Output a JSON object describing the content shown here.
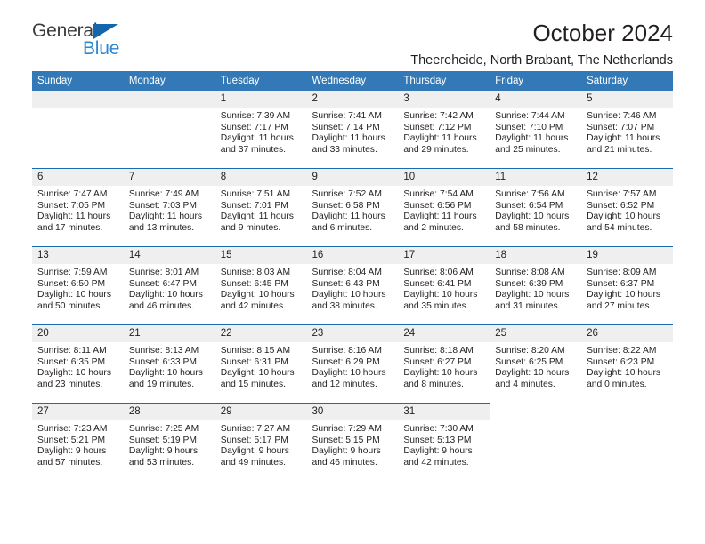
{
  "brand": {
    "word1": "General",
    "word2": "Blue",
    "triangle_color": "#1565ad",
    "word2_color": "#2f87d1"
  },
  "header": {
    "title": "October 2024",
    "subtitle": "Theereheide, North Brabant, The Netherlands"
  },
  "theme": {
    "header_bg": "#3379b7",
    "row_divider": "#1a6cb0",
    "daynum_bg": "#efefef",
    "text": "#231f20"
  },
  "weekdays": [
    "Sunday",
    "Monday",
    "Tuesday",
    "Wednesday",
    "Thursday",
    "Friday",
    "Saturday"
  ],
  "labels": {
    "sunrise": "Sunrise:",
    "sunset": "Sunset:",
    "daylight": "Daylight:"
  },
  "weeks": [
    [
      {
        "day": "",
        "empty": true
      },
      {
        "day": "",
        "empty": true
      },
      {
        "day": "1",
        "sunrise": "Sunrise: 7:39 AM",
        "sunset": "Sunset: 7:17 PM",
        "daylight": "Daylight: 11 hours and 37 minutes."
      },
      {
        "day": "2",
        "sunrise": "Sunrise: 7:41 AM",
        "sunset": "Sunset: 7:14 PM",
        "daylight": "Daylight: 11 hours and 33 minutes."
      },
      {
        "day": "3",
        "sunrise": "Sunrise: 7:42 AM",
        "sunset": "Sunset: 7:12 PM",
        "daylight": "Daylight: 11 hours and 29 minutes."
      },
      {
        "day": "4",
        "sunrise": "Sunrise: 7:44 AM",
        "sunset": "Sunset: 7:10 PM",
        "daylight": "Daylight: 11 hours and 25 minutes."
      },
      {
        "day": "5",
        "sunrise": "Sunrise: 7:46 AM",
        "sunset": "Sunset: 7:07 PM",
        "daylight": "Daylight: 11 hours and 21 minutes."
      }
    ],
    [
      {
        "day": "6",
        "sunrise": "Sunrise: 7:47 AM",
        "sunset": "Sunset: 7:05 PM",
        "daylight": "Daylight: 11 hours and 17 minutes."
      },
      {
        "day": "7",
        "sunrise": "Sunrise: 7:49 AM",
        "sunset": "Sunset: 7:03 PM",
        "daylight": "Daylight: 11 hours and 13 minutes."
      },
      {
        "day": "8",
        "sunrise": "Sunrise: 7:51 AM",
        "sunset": "Sunset: 7:01 PM",
        "daylight": "Daylight: 11 hours and 9 minutes."
      },
      {
        "day": "9",
        "sunrise": "Sunrise: 7:52 AM",
        "sunset": "Sunset: 6:58 PM",
        "daylight": "Daylight: 11 hours and 6 minutes."
      },
      {
        "day": "10",
        "sunrise": "Sunrise: 7:54 AM",
        "sunset": "Sunset: 6:56 PM",
        "daylight": "Daylight: 11 hours and 2 minutes."
      },
      {
        "day": "11",
        "sunrise": "Sunrise: 7:56 AM",
        "sunset": "Sunset: 6:54 PM",
        "daylight": "Daylight: 10 hours and 58 minutes."
      },
      {
        "day": "12",
        "sunrise": "Sunrise: 7:57 AM",
        "sunset": "Sunset: 6:52 PM",
        "daylight": "Daylight: 10 hours and 54 minutes."
      }
    ],
    [
      {
        "day": "13",
        "sunrise": "Sunrise: 7:59 AM",
        "sunset": "Sunset: 6:50 PM",
        "daylight": "Daylight: 10 hours and 50 minutes."
      },
      {
        "day": "14",
        "sunrise": "Sunrise: 8:01 AM",
        "sunset": "Sunset: 6:47 PM",
        "daylight": "Daylight: 10 hours and 46 minutes."
      },
      {
        "day": "15",
        "sunrise": "Sunrise: 8:03 AM",
        "sunset": "Sunset: 6:45 PM",
        "daylight": "Daylight: 10 hours and 42 minutes."
      },
      {
        "day": "16",
        "sunrise": "Sunrise: 8:04 AM",
        "sunset": "Sunset: 6:43 PM",
        "daylight": "Daylight: 10 hours and 38 minutes."
      },
      {
        "day": "17",
        "sunrise": "Sunrise: 8:06 AM",
        "sunset": "Sunset: 6:41 PM",
        "daylight": "Daylight: 10 hours and 35 minutes."
      },
      {
        "day": "18",
        "sunrise": "Sunrise: 8:08 AM",
        "sunset": "Sunset: 6:39 PM",
        "daylight": "Daylight: 10 hours and 31 minutes."
      },
      {
        "day": "19",
        "sunrise": "Sunrise: 8:09 AM",
        "sunset": "Sunset: 6:37 PM",
        "daylight": "Daylight: 10 hours and 27 minutes."
      }
    ],
    [
      {
        "day": "20",
        "sunrise": "Sunrise: 8:11 AM",
        "sunset": "Sunset: 6:35 PM",
        "daylight": "Daylight: 10 hours and 23 minutes."
      },
      {
        "day": "21",
        "sunrise": "Sunrise: 8:13 AM",
        "sunset": "Sunset: 6:33 PM",
        "daylight": "Daylight: 10 hours and 19 minutes."
      },
      {
        "day": "22",
        "sunrise": "Sunrise: 8:15 AM",
        "sunset": "Sunset: 6:31 PM",
        "daylight": "Daylight: 10 hours and 15 minutes."
      },
      {
        "day": "23",
        "sunrise": "Sunrise: 8:16 AM",
        "sunset": "Sunset: 6:29 PM",
        "daylight": "Daylight: 10 hours and 12 minutes."
      },
      {
        "day": "24",
        "sunrise": "Sunrise: 8:18 AM",
        "sunset": "Sunset: 6:27 PM",
        "daylight": "Daylight: 10 hours and 8 minutes."
      },
      {
        "day": "25",
        "sunrise": "Sunrise: 8:20 AM",
        "sunset": "Sunset: 6:25 PM",
        "daylight": "Daylight: 10 hours and 4 minutes."
      },
      {
        "day": "26",
        "sunrise": "Sunrise: 8:22 AM",
        "sunset": "Sunset: 6:23 PM",
        "daylight": "Daylight: 10 hours and 0 minutes."
      }
    ],
    [
      {
        "day": "27",
        "sunrise": "Sunrise: 7:23 AM",
        "sunset": "Sunset: 5:21 PM",
        "daylight": "Daylight: 9 hours and 57 minutes."
      },
      {
        "day": "28",
        "sunrise": "Sunrise: 7:25 AM",
        "sunset": "Sunset: 5:19 PM",
        "daylight": "Daylight: 9 hours and 53 minutes."
      },
      {
        "day": "29",
        "sunrise": "Sunrise: 7:27 AM",
        "sunset": "Sunset: 5:17 PM",
        "daylight": "Daylight: 9 hours and 49 minutes."
      },
      {
        "day": "30",
        "sunrise": "Sunrise: 7:29 AM",
        "sunset": "Sunset: 5:15 PM",
        "daylight": "Daylight: 9 hours and 46 minutes."
      },
      {
        "day": "31",
        "sunrise": "Sunrise: 7:30 AM",
        "sunset": "Sunset: 5:13 PM",
        "daylight": "Daylight: 9 hours and 42 minutes."
      },
      {
        "day": "",
        "empty": true,
        "trailing": true
      },
      {
        "day": "",
        "empty": true,
        "trailing": true
      }
    ]
  ]
}
